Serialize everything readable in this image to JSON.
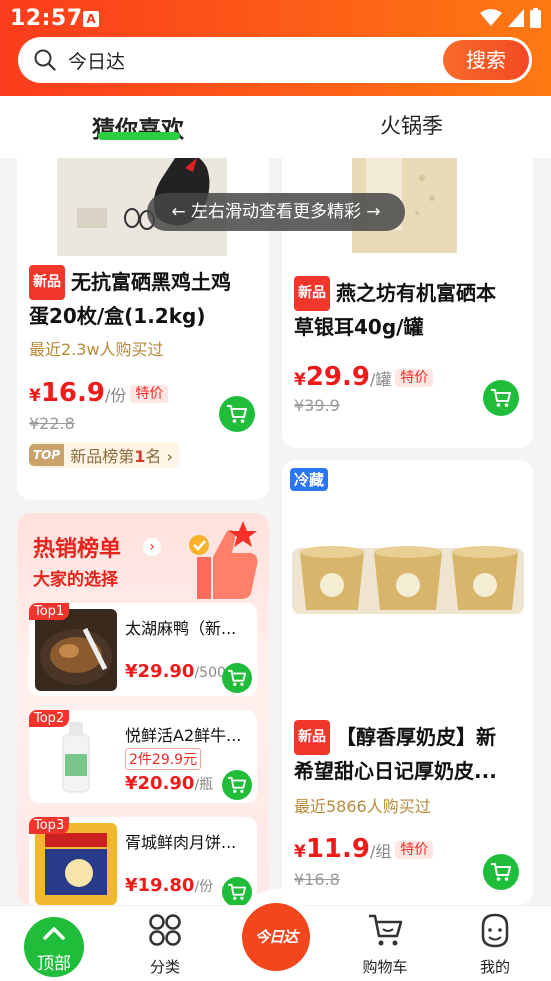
{
  "status_bar": {
    "time": "12:57",
    "app_icon": "A"
  },
  "search": {
    "value": "今日达",
    "button_label": "搜索"
  },
  "tabs": [
    {
      "label": "猜你喜欢"
    },
    {
      "label": "火锅季"
    }
  ],
  "swipe_hint": {
    "text": "左右滑动查看更多精彩"
  },
  "products": [
    {
      "tag": "新品",
      "title": "无抗富硒黑鸡土鸡蛋20枚/盒(1.2kg)",
      "title_line1": "无抗富硒黑鸡土鸡",
      "title_line2": "蛋20枚/盒(1.2kg)",
      "sold": "最近2.3w人购买过",
      "price_symbol": "¥",
      "price": "16.9",
      "unit": "/份",
      "special": "特价",
      "original_price": "¥22.8",
      "rank_badge": "TOP",
      "rank_text_prefix": "新品榜第",
      "rank_number": "1",
      "rank_text_suffix": "名",
      "rank_arrow": "›"
    },
    {
      "tag": "新品",
      "title_line1": "燕之坊有机富硒本",
      "title_line2": "草银耳40g/罐",
      "price_symbol": "¥",
      "price": "29.9",
      "unit": "/罐",
      "special": "特价",
      "original_price": "¥39.9"
    },
    {
      "cold_tag": "冷藏",
      "tag": "新品",
      "title_line1": "【醇香厚奶皮】新",
      "title_line2": "希望甜心日记厚奶皮...",
      "sold": "最近5866人购买过",
      "price_symbol": "¥",
      "price": "11.9",
      "unit": "/组",
      "special": "特价",
      "original_price": "¥16.8"
    }
  ],
  "hot_list": {
    "title": "热销榜单",
    "arrow": "›",
    "subtitle": "大家的选择",
    "items": [
      {
        "rank": "Top1",
        "name": "太湖麻鸭（新...",
        "price": "¥29.90",
        "unit": "/500g"
      },
      {
        "rank": "Top2",
        "name": "悦鲜活A2鲜牛...",
        "promo": "2件29.9元",
        "price": "¥20.90",
        "unit": "/瓶"
      },
      {
        "rank": "Top3",
        "name": "胥城鲜肉月饼...",
        "price": "¥19.80",
        "unit": "/份"
      }
    ]
  },
  "bottom_nav": {
    "top_label": "顶部",
    "category_label": "分类",
    "center_label": "今日达",
    "cart_label": "购物车",
    "mine_label": "我的"
  },
  "colors": {
    "brand": "#f2471c",
    "cart_green": "#1fbd3a",
    "price_red": "#ef1b1b"
  }
}
